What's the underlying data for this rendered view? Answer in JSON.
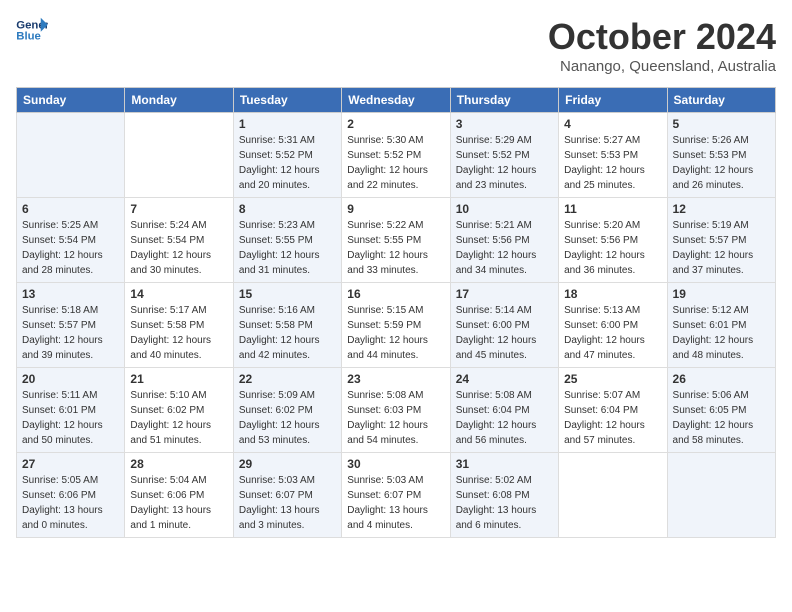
{
  "header": {
    "logo_line1": "General",
    "logo_line2": "Blue",
    "month": "October 2024",
    "location": "Nanango, Queensland, Australia"
  },
  "weekdays": [
    "Sunday",
    "Monday",
    "Tuesday",
    "Wednesday",
    "Thursday",
    "Friday",
    "Saturday"
  ],
  "weeks": [
    [
      {
        "day": "",
        "info": ""
      },
      {
        "day": "",
        "info": ""
      },
      {
        "day": "1",
        "info": "Sunrise: 5:31 AM\nSunset: 5:52 PM\nDaylight: 12 hours\nand 20 minutes."
      },
      {
        "day": "2",
        "info": "Sunrise: 5:30 AM\nSunset: 5:52 PM\nDaylight: 12 hours\nand 22 minutes."
      },
      {
        "day": "3",
        "info": "Sunrise: 5:29 AM\nSunset: 5:52 PM\nDaylight: 12 hours\nand 23 minutes."
      },
      {
        "day": "4",
        "info": "Sunrise: 5:27 AM\nSunset: 5:53 PM\nDaylight: 12 hours\nand 25 minutes."
      },
      {
        "day": "5",
        "info": "Sunrise: 5:26 AM\nSunset: 5:53 PM\nDaylight: 12 hours\nand 26 minutes."
      }
    ],
    [
      {
        "day": "6",
        "info": "Sunrise: 5:25 AM\nSunset: 5:54 PM\nDaylight: 12 hours\nand 28 minutes."
      },
      {
        "day": "7",
        "info": "Sunrise: 5:24 AM\nSunset: 5:54 PM\nDaylight: 12 hours\nand 30 minutes."
      },
      {
        "day": "8",
        "info": "Sunrise: 5:23 AM\nSunset: 5:55 PM\nDaylight: 12 hours\nand 31 minutes."
      },
      {
        "day": "9",
        "info": "Sunrise: 5:22 AM\nSunset: 5:55 PM\nDaylight: 12 hours\nand 33 minutes."
      },
      {
        "day": "10",
        "info": "Sunrise: 5:21 AM\nSunset: 5:56 PM\nDaylight: 12 hours\nand 34 minutes."
      },
      {
        "day": "11",
        "info": "Sunrise: 5:20 AM\nSunset: 5:56 PM\nDaylight: 12 hours\nand 36 minutes."
      },
      {
        "day": "12",
        "info": "Sunrise: 5:19 AM\nSunset: 5:57 PM\nDaylight: 12 hours\nand 37 minutes."
      }
    ],
    [
      {
        "day": "13",
        "info": "Sunrise: 5:18 AM\nSunset: 5:57 PM\nDaylight: 12 hours\nand 39 minutes."
      },
      {
        "day": "14",
        "info": "Sunrise: 5:17 AM\nSunset: 5:58 PM\nDaylight: 12 hours\nand 40 minutes."
      },
      {
        "day": "15",
        "info": "Sunrise: 5:16 AM\nSunset: 5:58 PM\nDaylight: 12 hours\nand 42 minutes."
      },
      {
        "day": "16",
        "info": "Sunrise: 5:15 AM\nSunset: 5:59 PM\nDaylight: 12 hours\nand 44 minutes."
      },
      {
        "day": "17",
        "info": "Sunrise: 5:14 AM\nSunset: 6:00 PM\nDaylight: 12 hours\nand 45 minutes."
      },
      {
        "day": "18",
        "info": "Sunrise: 5:13 AM\nSunset: 6:00 PM\nDaylight: 12 hours\nand 47 minutes."
      },
      {
        "day": "19",
        "info": "Sunrise: 5:12 AM\nSunset: 6:01 PM\nDaylight: 12 hours\nand 48 minutes."
      }
    ],
    [
      {
        "day": "20",
        "info": "Sunrise: 5:11 AM\nSunset: 6:01 PM\nDaylight: 12 hours\nand 50 minutes."
      },
      {
        "day": "21",
        "info": "Sunrise: 5:10 AM\nSunset: 6:02 PM\nDaylight: 12 hours\nand 51 minutes."
      },
      {
        "day": "22",
        "info": "Sunrise: 5:09 AM\nSunset: 6:02 PM\nDaylight: 12 hours\nand 53 minutes."
      },
      {
        "day": "23",
        "info": "Sunrise: 5:08 AM\nSunset: 6:03 PM\nDaylight: 12 hours\nand 54 minutes."
      },
      {
        "day": "24",
        "info": "Sunrise: 5:08 AM\nSunset: 6:04 PM\nDaylight: 12 hours\nand 56 minutes."
      },
      {
        "day": "25",
        "info": "Sunrise: 5:07 AM\nSunset: 6:04 PM\nDaylight: 12 hours\nand 57 minutes."
      },
      {
        "day": "26",
        "info": "Sunrise: 5:06 AM\nSunset: 6:05 PM\nDaylight: 12 hours\nand 58 minutes."
      }
    ],
    [
      {
        "day": "27",
        "info": "Sunrise: 5:05 AM\nSunset: 6:06 PM\nDaylight: 13 hours\nand 0 minutes."
      },
      {
        "day": "28",
        "info": "Sunrise: 5:04 AM\nSunset: 6:06 PM\nDaylight: 13 hours\nand 1 minute."
      },
      {
        "day": "29",
        "info": "Sunrise: 5:03 AM\nSunset: 6:07 PM\nDaylight: 13 hours\nand 3 minutes."
      },
      {
        "day": "30",
        "info": "Sunrise: 5:03 AM\nSunset: 6:07 PM\nDaylight: 13 hours\nand 4 minutes."
      },
      {
        "day": "31",
        "info": "Sunrise: 5:02 AM\nSunset: 6:08 PM\nDaylight: 13 hours\nand 6 minutes."
      },
      {
        "day": "",
        "info": ""
      },
      {
        "day": "",
        "info": ""
      }
    ]
  ]
}
